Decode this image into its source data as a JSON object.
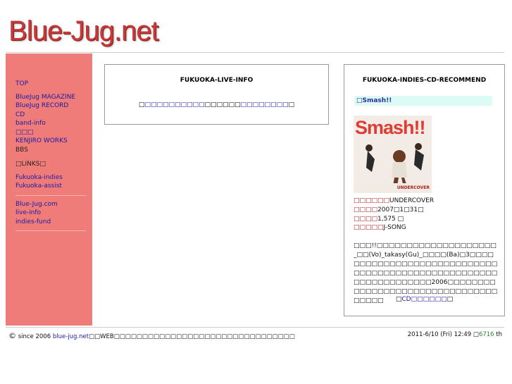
{
  "site": {
    "logo": "Blue-Jug.net"
  },
  "sidebar": {
    "items": [
      "TOP",
      "BlueJug MAGAZINE",
      "BlueJug RECORD",
      "CD",
      "band-info",
      "□□□",
      "KENJIRO WORKS",
      "BBS"
    ],
    "links_heading": "□LINKS□",
    "links": [
      "Fukuoka-indies",
      "Fukuoka-assist"
    ],
    "external": [
      "Blue-Jug.com",
      "live-info",
      "indies-fund"
    ]
  },
  "live_box": {
    "title": "FUKUOKA-LIVE-INFO",
    "text_prefix": "□",
    "link1": "□□□□□□□□□□",
    "text_mid": "□□□□□□",
    "link2": "□□□□□□□□",
    "text_suffix": "□"
  },
  "cd_box": {
    "title": "FUKUOKA-INDIES-CD-RECOMMEND",
    "highlight": "□Smash!!",
    "cover_title": "Smash!!",
    "cover_sub": "UNDERCOVER",
    "artist_label": "□□□□□□",
    "artist": "UNDERCOVER",
    "date_label": "□□□□",
    "date": "2007□1□31□",
    "price_label": "□□□□",
    "price": "1,575 □",
    "label_label": "□□□□□",
    "label": "J-SONG",
    "description": "□□□!!□□□□□□□□□□□□□□□□□□□□_□□(Vo)_takasy(Gu)_□□□□(Ba)□3□□□□□□□□□□□□□□□□□□□□□□□□□□□□□□□□□□□□□□□□□□□□□□□□□□□□□□□□□□□□□□□□□2006□□□□□□□□□□□□□□□□□□□□□□□□□□□□□□□□□□□□□",
    "cd_link_prefix": "□",
    "cd_link": "CD□□□□□□",
    "cd_link_suffix": "□"
  },
  "footer": {
    "copyright_symbol": "©",
    "since": " since 2006 ",
    "site_link": "blue-jug.net",
    "notice": "□□WEB□□□□□□□□□□□□□□□□□□□□□□□□□□□□□□□□",
    "datetime": "2011-6/10 (Fri) 12:49 □",
    "counter": "6716",
    "counter_suffix": " th"
  }
}
